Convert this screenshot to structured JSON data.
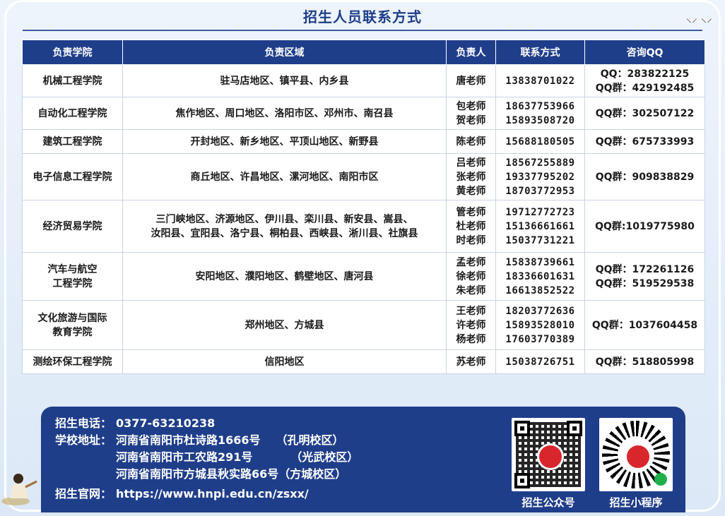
{
  "title": "招生人员联系方式",
  "table": {
    "headers": [
      "负责学院",
      "负责区域",
      "负责人",
      "联系方式",
      "咨询QQ"
    ],
    "rows": [
      {
        "college": "机械工程学院",
        "region": [
          "驻马店地区、镇平县、内乡县"
        ],
        "person": [
          "唐老师"
        ],
        "phone": [
          "13838701022"
        ],
        "qq": [
          "QQ：283822125",
          "QQ群：429192485"
        ]
      },
      {
        "college": "自动化工程学院",
        "region": [
          "焦作地区、周口地区、洛阳市区、邓州市、南召县"
        ],
        "person": [
          "包老师",
          "贺老师"
        ],
        "phone": [
          "18637753966",
          "15893508720"
        ],
        "qq": [
          "QQ群：302507122"
        ]
      },
      {
        "college": "建筑工程学院",
        "region": [
          "开封地区、新乡地区、平顶山地区、新野县"
        ],
        "person": [
          "陈老师"
        ],
        "phone": [
          "15688180505"
        ],
        "qq": [
          "QQ群：675733993"
        ]
      },
      {
        "college": "电子信息工程学院",
        "region": [
          "商丘地区、许昌地区、漯河地区、南阳市区"
        ],
        "person": [
          "吕老师",
          "张老师",
          "黄老师"
        ],
        "phone": [
          "18567255889",
          "19337795202",
          "18703772953"
        ],
        "qq": [
          "QQ群：909838829"
        ]
      },
      {
        "college": "经济贸易学院",
        "region": [
          "三门峡地区、济源地区、伊川县、栾川县、新安县、嵩县、",
          "汝阳县、宜阳县、洛宁县、桐柏县、西峡县、淅川县、社旗县"
        ],
        "person": [
          "管老师",
          "杜老师",
          "时老师"
        ],
        "phone": [
          "19712772723",
          "15136661661",
          "15037731221"
        ],
        "qq": [
          "QQ群:1019775980"
        ]
      },
      {
        "college": [
          "汽车与航空",
          "工程学院"
        ],
        "region": [
          "安阳地区、濮阳地区、鹤壁地区、唐河县"
        ],
        "person": [
          "孟老师",
          "徐老师",
          "朱老师"
        ],
        "phone": [
          "15838739661",
          "18336601631",
          "16613852522"
        ],
        "qq": [
          "QQ群：172261126",
          "QQ群：519529538"
        ]
      },
      {
        "college": [
          "文化旅游与国际",
          "教育学院"
        ],
        "region": [
          "郑州地区、方城县"
        ],
        "person": [
          "王老师",
          "许老师",
          "杨老师"
        ],
        "phone": [
          "18203772636",
          "15893528010",
          "17603770389"
        ],
        "qq": [
          "QQ群：1037604458"
        ]
      },
      {
        "college": "测绘环保工程学院",
        "region": [
          "信阳地区"
        ],
        "person": [
          "苏老师"
        ],
        "phone": [
          "15038726751"
        ],
        "qq": [
          "QQ群：518805998"
        ]
      }
    ]
  },
  "footer": {
    "phone_label": "招生电话：",
    "phone_value": "0377-63210238",
    "address_label": "学校地址：",
    "addresses": [
      {
        "addr": "河南省南阳市杜诗路1666号",
        "campus": "（孔明校区）"
      },
      {
        "addr": "河南省南阳市工农路291号",
        "campus": "（光武校区）"
      },
      {
        "addr": "河南省南阳市方城县秋实路66号",
        "campus": "（方城校区）"
      }
    ],
    "website_label": "招生官网：",
    "website_value": "https://www.hnpi.edu.cn/zsxx/",
    "qr1_caption": "招生公众号",
    "qr2_caption": "招生小程序"
  }
}
